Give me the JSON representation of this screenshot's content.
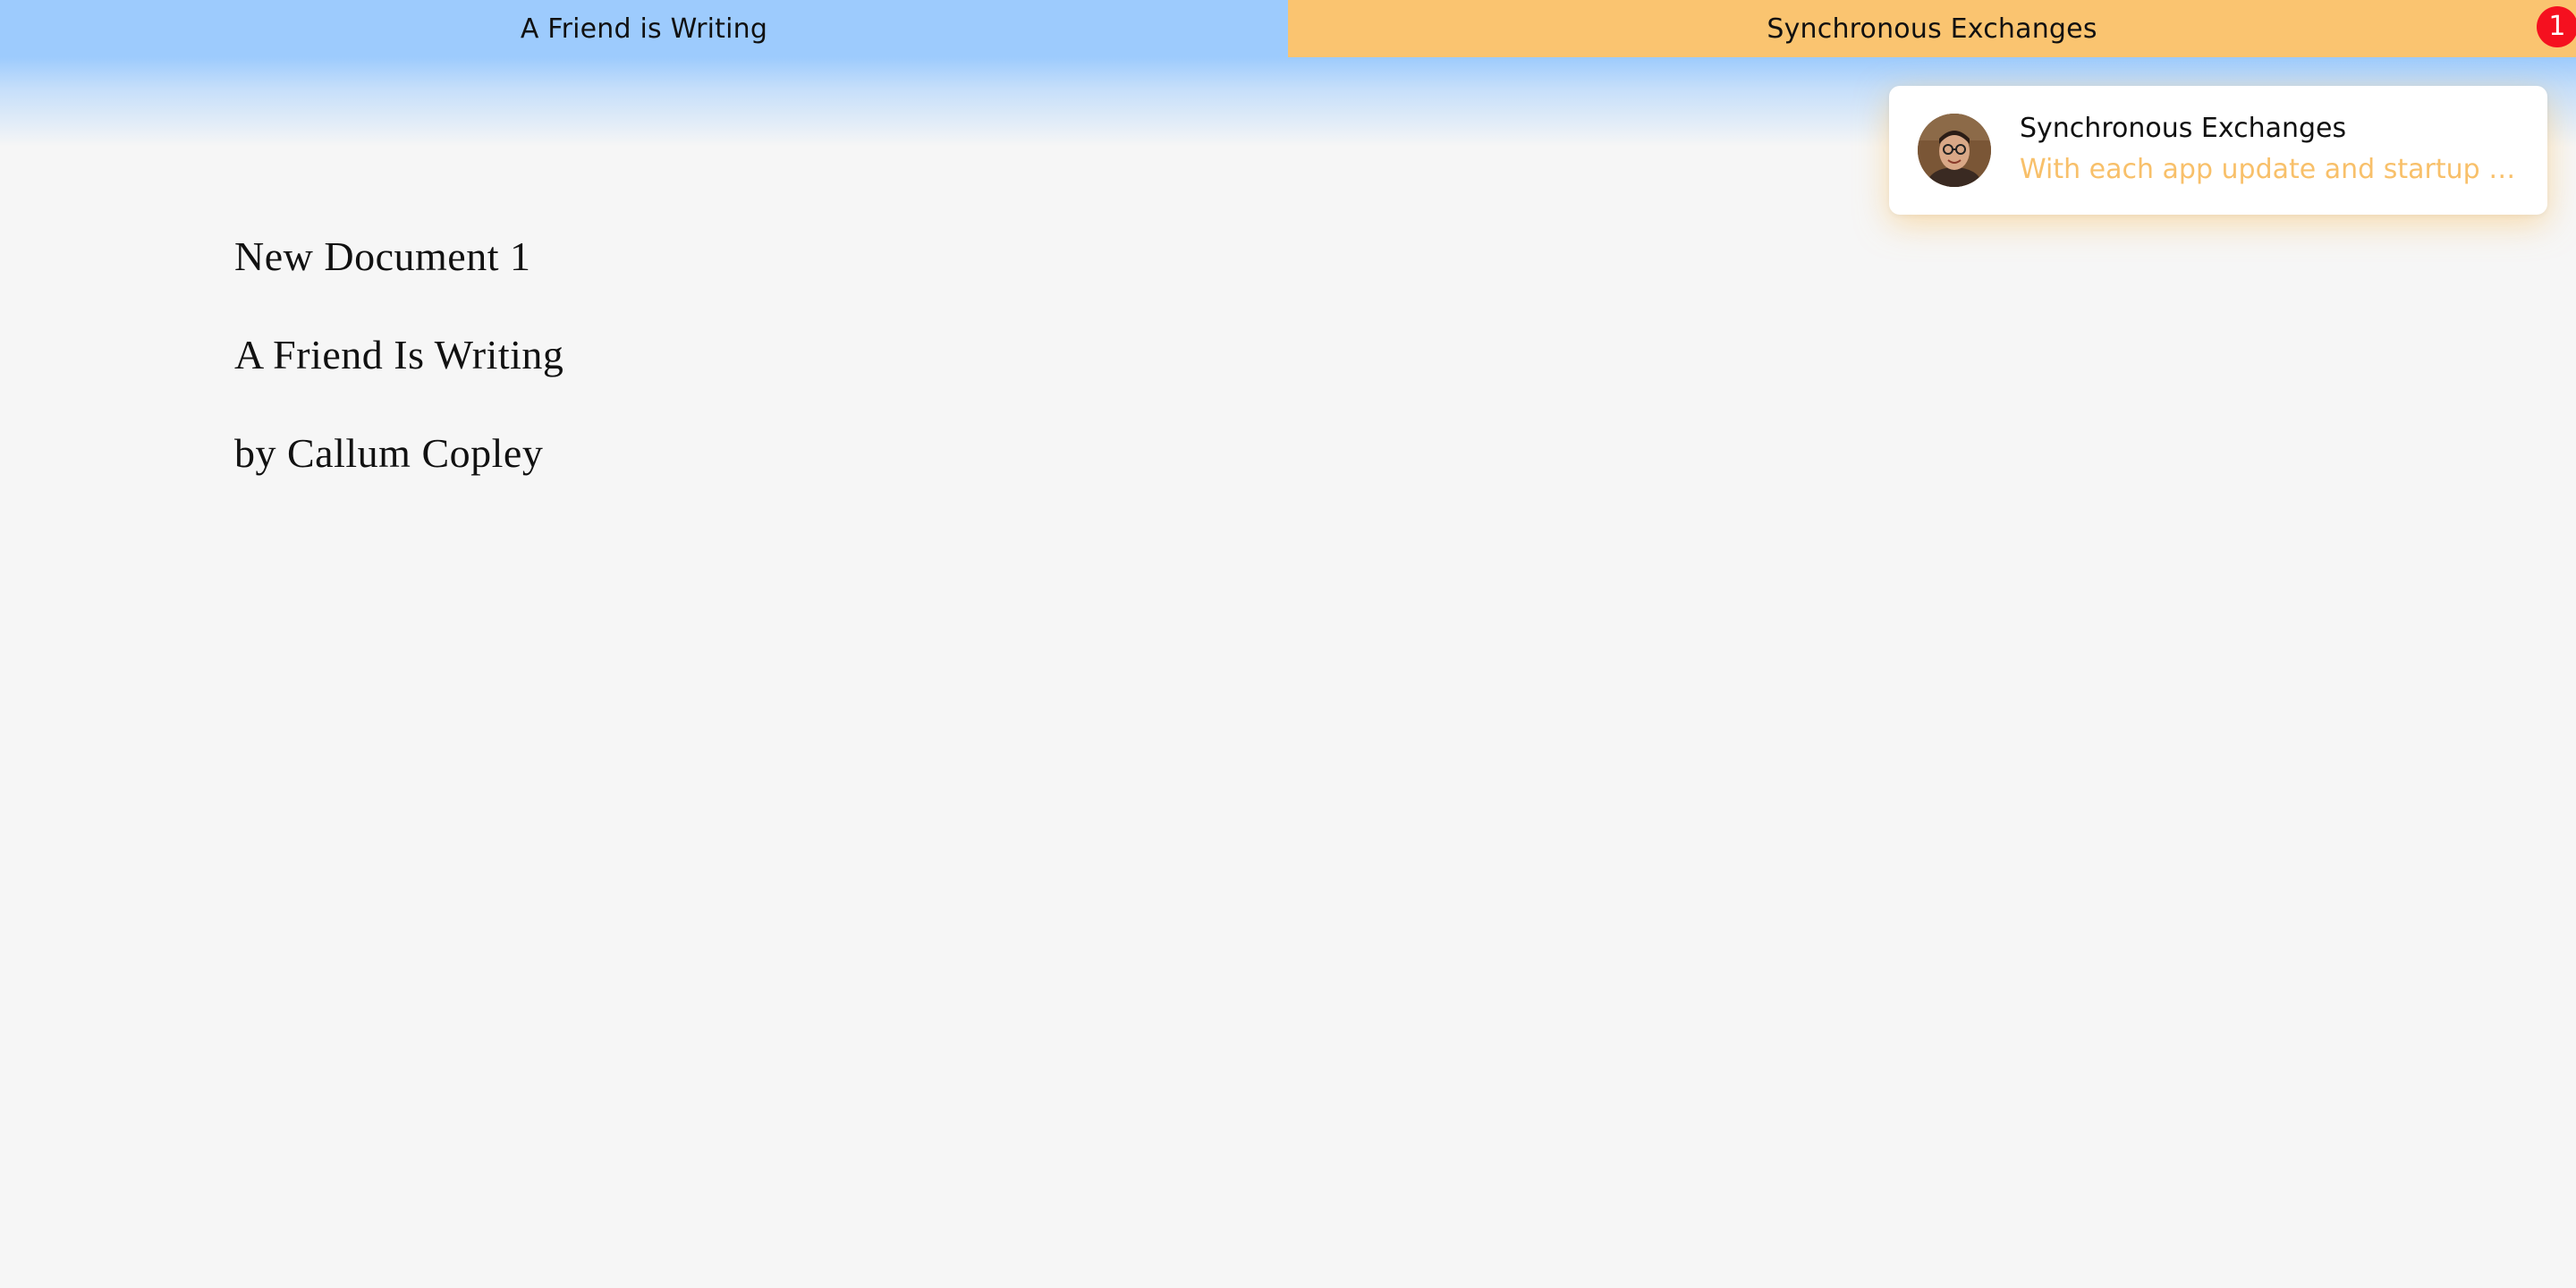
{
  "tabs": [
    {
      "label": "A Friend is Writing",
      "color": "#9dcbfd"
    },
    {
      "label": "Synchronous Exchanges",
      "color": "#fac470",
      "badge": "1"
    }
  ],
  "document": {
    "lines": [
      "New Document 1",
      "A Friend Is Writing",
      "by Callum Copley"
    ]
  },
  "notification": {
    "avatar": "user-avatar-photo",
    "title": "Synchronous Exchanges",
    "message": "With each app update and startup la...",
    "accent": "#f8c06a"
  },
  "colors": {
    "background": "#f6f6f6",
    "badge": "#f5101f"
  }
}
